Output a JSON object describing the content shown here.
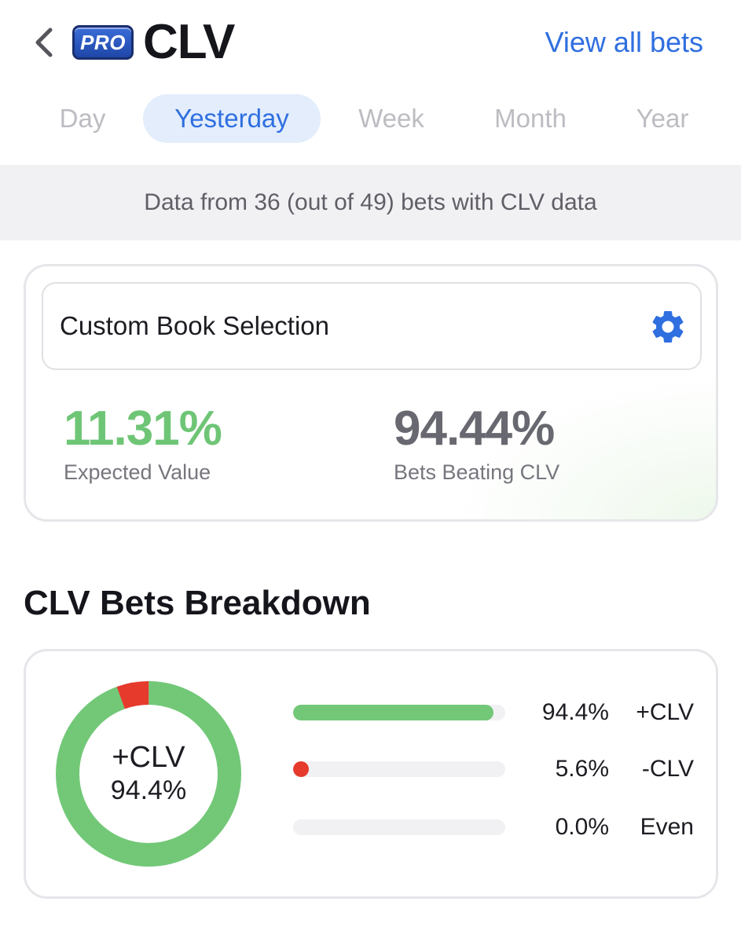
{
  "header": {
    "back_icon": "chevron-left-icon",
    "badge_text": "PRO",
    "title": "CLV",
    "view_all_label": "View all bets"
  },
  "tabs": [
    {
      "label": "Day",
      "active": false
    },
    {
      "label": "Yesterday",
      "active": true
    },
    {
      "label": "Week",
      "active": false
    },
    {
      "label": "Month",
      "active": false
    },
    {
      "label": "Year",
      "active": false
    }
  ],
  "banner": {
    "text": "Data from 36 (out of 49) bets with CLV data"
  },
  "summary": {
    "book_selection_label": "Custom Book Selection",
    "settings_icon": "gear-icon",
    "expected_value": "11.31%",
    "expected_value_label": "Expected Value",
    "bets_beating": "94.44%",
    "bets_beating_label": "Bets Beating CLV"
  },
  "breakdown": {
    "title": "CLV Bets Breakdown",
    "donut_label": "+CLV",
    "donut_value": "94.4%",
    "rows": [
      {
        "pct_text": "94.4%",
        "name": "+CLV",
        "value": 94.4,
        "color": "#72c877"
      },
      {
        "pct_text": "5.6%",
        "name": "-CLV",
        "value": 5.6,
        "color": "#e53a2c"
      },
      {
        "pct_text": "0.0%",
        "name": "Even",
        "value": 0.0,
        "color": "#bfbfc5"
      }
    ]
  },
  "colors": {
    "accent": "#2f6fe0",
    "positive": "#72c877",
    "negative": "#e53a2c"
  }
}
